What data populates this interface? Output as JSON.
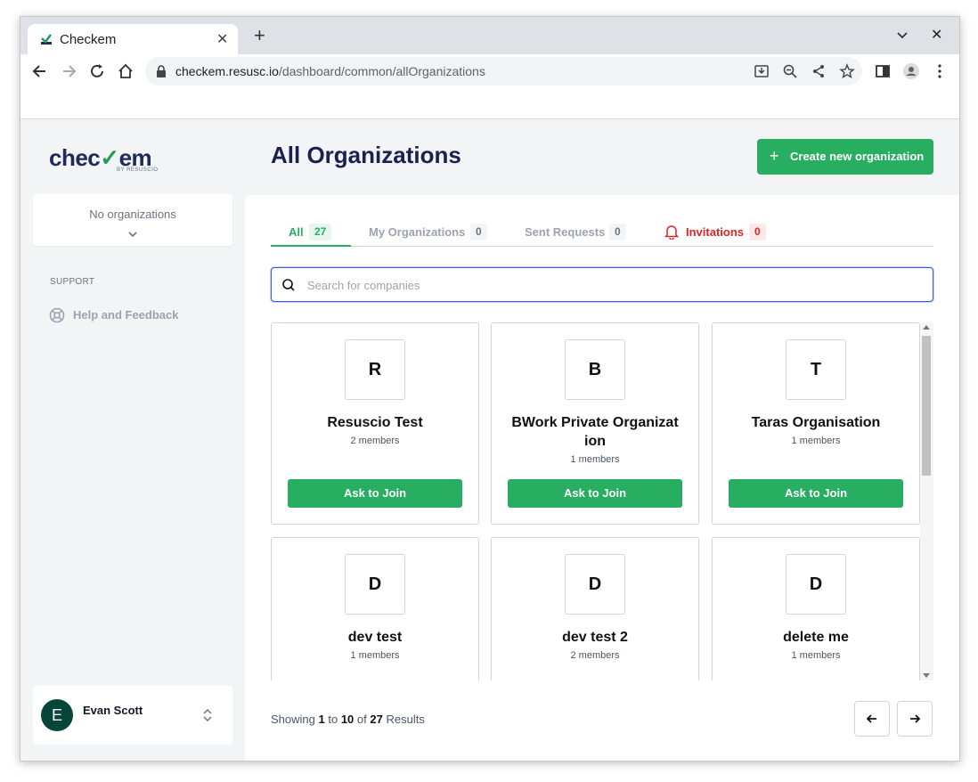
{
  "browser": {
    "tab_title": "Checkem",
    "url_host": "checkem.resusc.io",
    "url_path": "/dashboard/common/allOrganizations"
  },
  "sidebar": {
    "logo_text_a": "chec",
    "logo_text_b": "em",
    "logo_sub": "BY RESUSCIO",
    "org_selector": "No organizations",
    "section_label": "SUPPORT",
    "help_label": "Help and Feedback",
    "user": {
      "initial": "E",
      "name": "Evan Scott"
    }
  },
  "main": {
    "title": "All Organizations",
    "create_button": "Create new organization",
    "tabs": [
      {
        "label": "All",
        "count": "27"
      },
      {
        "label": "My Organizations",
        "count": "0"
      },
      {
        "label": "Sent Requests",
        "count": "0"
      },
      {
        "label": "Invitations",
        "count": "0"
      }
    ],
    "search_placeholder": "Search for companies",
    "cards": [
      {
        "letter": "R",
        "name": "Resuscio Test",
        "members": "2 members",
        "action": "Ask to Join"
      },
      {
        "letter": "B",
        "name": "BWork Private Organizat ion",
        "members": "1 members",
        "action": "Ask to Join"
      },
      {
        "letter": "T",
        "name": "Taras Organisation",
        "members": "1 members",
        "action": "Ask to Join"
      },
      {
        "letter": "D",
        "name": "dev test",
        "members": "1 members"
      },
      {
        "letter": "D",
        "name": "dev test 2",
        "members": "2 members"
      },
      {
        "letter": "D",
        "name": "delete me",
        "members": "1 members"
      }
    ],
    "pagination": {
      "showing": "Showing",
      "from": "1",
      "to_word": "to",
      "to": "10",
      "of_word": "of",
      "total": "27",
      "results": "Results"
    }
  },
  "colors": {
    "accent": "#27ae60",
    "title": "#1a2150",
    "danger": "#dc2626"
  }
}
